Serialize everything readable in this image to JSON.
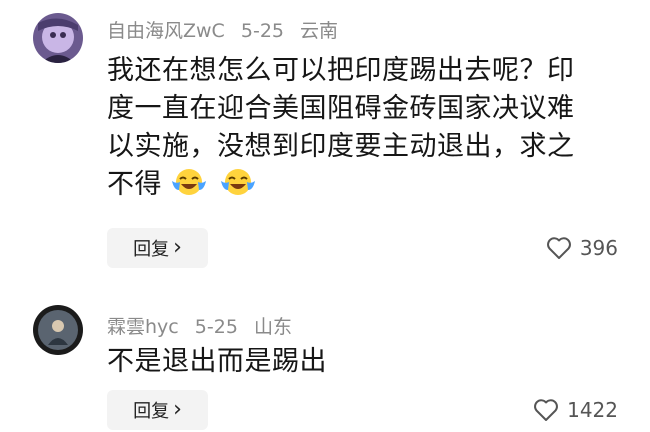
{
  "comments": [
    {
      "username": "自由海风ZwC",
      "date": "5-25",
      "location": "云南",
      "lines": [
        "我还在想怎么可以把印度踢出去呢？印",
        "度一直在迎合美国阻碍金砖国家决议难",
        "以实施，没想到印度要主动退出，求之",
        "不得"
      ],
      "emoji_count": 2,
      "reply_label": "回复",
      "reply_arrow": "›",
      "likes": "396"
    },
    {
      "username": "霖雲hyc",
      "date": "5-25",
      "location": "山东",
      "lines": [
        "不是退出而是踢出"
      ],
      "reply_label": "回复",
      "reply_arrow": "›",
      "likes": "1422"
    }
  ]
}
